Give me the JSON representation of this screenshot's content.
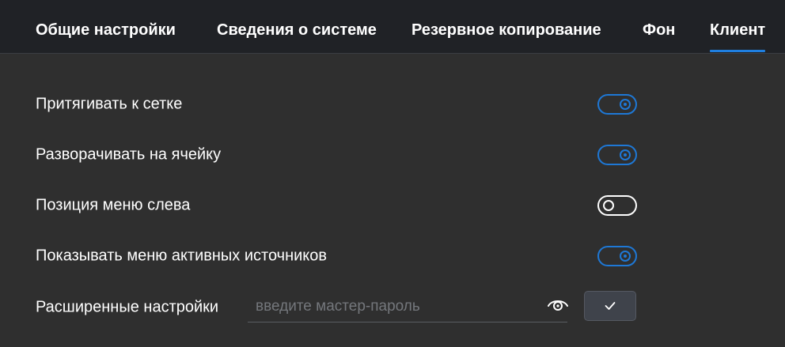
{
  "tabs": [
    {
      "label": "Общие настройки",
      "active": false
    },
    {
      "label": "Сведения о системе",
      "active": false
    },
    {
      "label": "Резервное копирование",
      "active": false
    },
    {
      "label": "Фон",
      "active": false
    },
    {
      "label": "Клиент",
      "active": true
    }
  ],
  "settings": [
    {
      "label": "Притягивать к сетке",
      "enabled": true
    },
    {
      "label": "Разворачивать на ячейку",
      "enabled": true
    },
    {
      "label": "Позиция меню слева",
      "enabled": false
    },
    {
      "label": "Показывать меню активных источников",
      "enabled": true
    }
  ],
  "advanced": {
    "label": "Расширенные настройки",
    "password_placeholder": "введите мастер-пароль",
    "password_value": ""
  },
  "icons": {
    "visibility": "eye-icon",
    "confirm": "check-icon"
  },
  "colors": {
    "accent": "#1e78d6",
    "background": "#2f2f2f",
    "tabbar": "#202226",
    "button": "#3f434b"
  }
}
